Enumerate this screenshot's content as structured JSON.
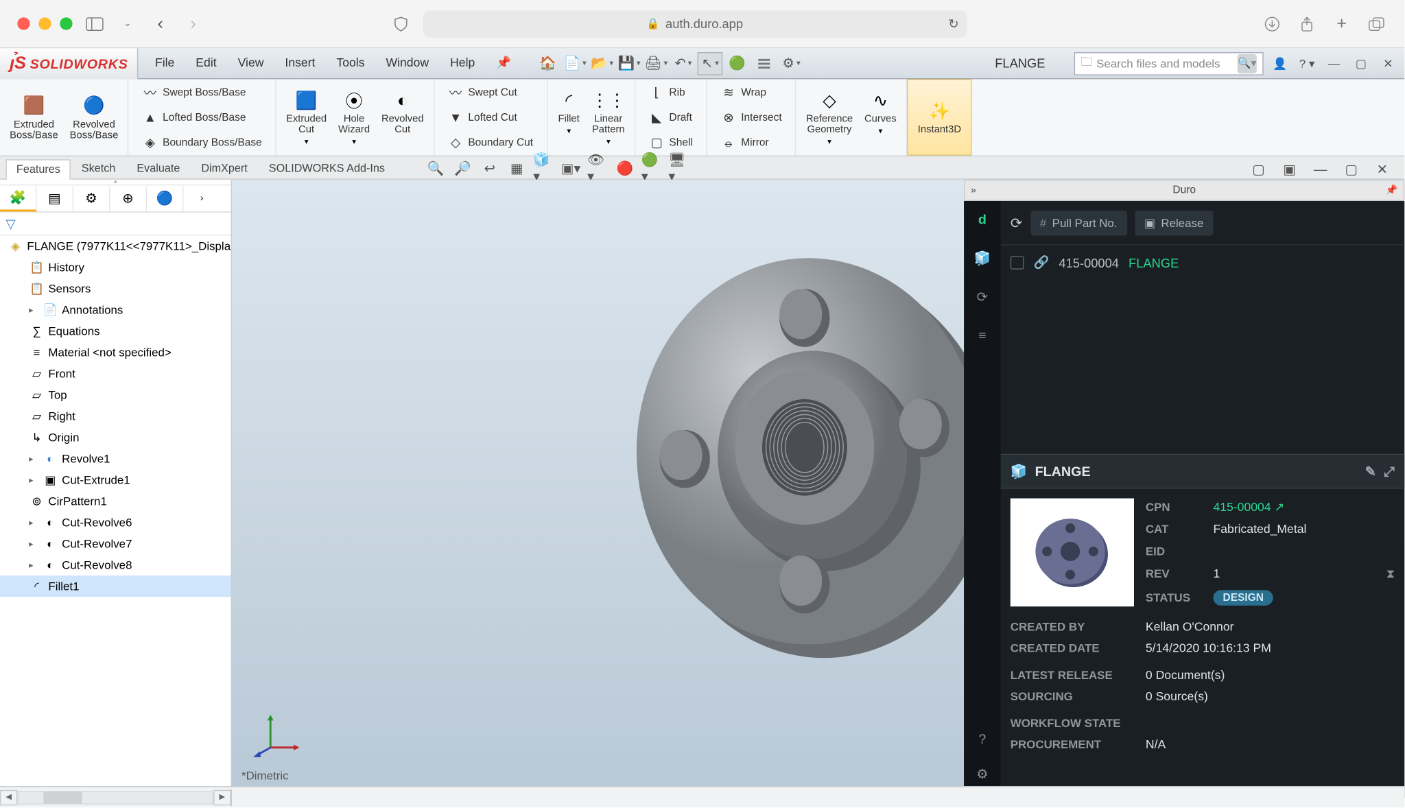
{
  "browser": {
    "url": "auth.duro.app"
  },
  "app": {
    "brand": "SOLIDWORKS",
    "document": "FLANGE",
    "search_placeholder": "Search files and models",
    "menus": [
      "File",
      "Edit",
      "View",
      "Insert",
      "Tools",
      "Window",
      "Help"
    ]
  },
  "ribbon": {
    "extruded_boss": "Extruded\nBoss/Base",
    "revolved_boss": "Revolved\nBoss/Base",
    "swept_boss": "Swept Boss/Base",
    "lofted_boss": "Lofted Boss/Base",
    "boundary_boss": "Boundary Boss/Base",
    "extruded_cut": "Extruded\nCut",
    "hole_wizard": "Hole\nWizard",
    "revolved_cut": "Revolved\nCut",
    "swept_cut": "Swept Cut",
    "lofted_cut": "Lofted Cut",
    "boundary_cut": "Boundary Cut",
    "fillet": "Fillet",
    "linear_pattern": "Linear\nPattern",
    "rib": "Rib",
    "draft": "Draft",
    "shell": "Shell",
    "wrap": "Wrap",
    "intersect": "Intersect",
    "mirror": "Mirror",
    "ref_geom": "Reference\nGeometry",
    "curves": "Curves",
    "instant3d": "Instant3D"
  },
  "tabs": [
    "Features",
    "Sketch",
    "Evaluate",
    "DimXpert",
    "SOLIDWORKS Add-Ins"
  ],
  "tree": {
    "root": "FLANGE  (7977K11<<7977K11>_Displa",
    "items": [
      "History",
      "Sensors",
      "Annotations",
      "Equations",
      "Material <not specified>",
      "Front",
      "Top",
      "Right",
      "Origin",
      "Revolve1",
      "Cut-Extrude1",
      "CirPattern1",
      "Cut-Revolve6",
      "Cut-Revolve7",
      "Cut-Revolve8",
      "Fillet1"
    ]
  },
  "viewport": {
    "view_label": "*Dimetric"
  },
  "duro": {
    "panel_title": "Duro",
    "pull_placeholder": "Pull Part No.",
    "release_btn": "Release",
    "row": {
      "pn": "415-00004",
      "name": "FLANGE"
    },
    "detail_title": "FLANGE",
    "fields": {
      "cpn_label": "CPN",
      "cpn": "415-00004",
      "cat_label": "CAT",
      "cat": "Fabricated_Metal",
      "eid_label": "EID",
      "eid": "",
      "rev_label": "REV",
      "rev": "1",
      "status_label": "STATUS",
      "status": "DESIGN"
    },
    "meta": {
      "created_by_label": "CREATED BY",
      "created_by": "Kellan O'Connor",
      "created_date_label": "CREATED DATE",
      "created_date": "5/14/2020 10:16:13 PM",
      "latest_release_label": "LATEST RELEASE",
      "latest_release": "0 Document(s)",
      "sourcing_label": "SOURCING",
      "sourcing": "0 Source(s)",
      "workflow_label": "WORKFLOW STATE",
      "workflow": "",
      "procurement_label": "PROCUREMENT",
      "procurement": "N/A"
    }
  }
}
